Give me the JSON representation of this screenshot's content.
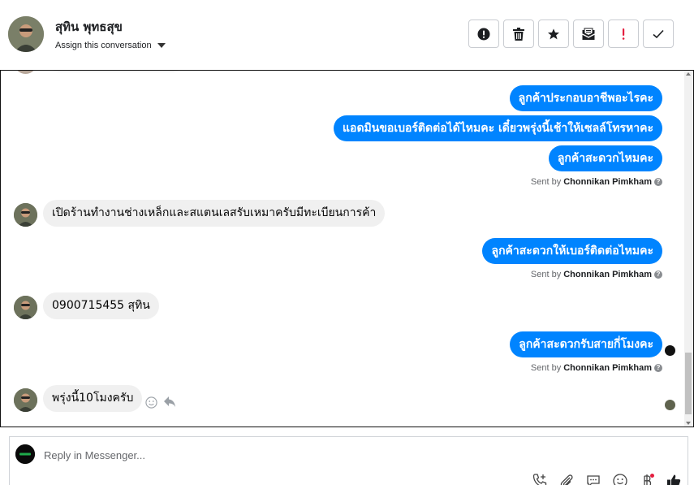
{
  "header": {
    "contact_name": "สุทิน พุทธสุข",
    "assign_label": "Assign this conversation"
  },
  "toolbar": {
    "spam_icon": "exclamation-circle-icon",
    "delete_icon": "trash-icon",
    "star_icon": "star-icon",
    "unread_icon": "envelope-icon",
    "important_icon": "exclamation-icon",
    "done_icon": "check-icon",
    "important_color": "#e41e3f"
  },
  "messages": [
    {
      "dir": "out",
      "text": "ลูกค้าประกอบอาชีพอะไรคะ"
    },
    {
      "dir": "out",
      "text": "แอดมินขอเบอร์ติดต่อได้ไหมคะ เดี๋ยวพรุ่งนี้เช้าให้เซลล์โทรหาคะ"
    },
    {
      "dir": "out",
      "text": "ลูกค้าสะดวกไหมคะ"
    },
    {
      "dir": "in",
      "text": "เปิดร้านทำงานช่างเหล็กและสแตนเลสรับเหมาครับมีทะเบียนการค้า"
    },
    {
      "dir": "out",
      "text": "ลูกค้าสะดวกให้เบอร์ติดต่อไหมคะ"
    },
    {
      "dir": "in",
      "text": "0900715455 สุทิน"
    },
    {
      "dir": "out",
      "text": "ลูกค้าสะดวกรับสายกี่โมงคะ"
    },
    {
      "dir": "in",
      "text": "พรุ่งนี้10โมงครับ"
    }
  ],
  "sent_by": {
    "prefix": "Sent by",
    "agent": "Chonnikan Pimkham",
    "help": "?"
  },
  "composer": {
    "placeholder": "Reply in Messenger...",
    "icons": [
      "phone-plus-icon",
      "paperclip-icon",
      "saved-reply-icon",
      "emoji-icon",
      "baht-icon",
      "like-icon"
    ],
    "notification_color": "#e41e3f"
  },
  "colors": {
    "outgoing_bubble": "#0084ff",
    "incoming_bubble": "#f0f0f0"
  }
}
